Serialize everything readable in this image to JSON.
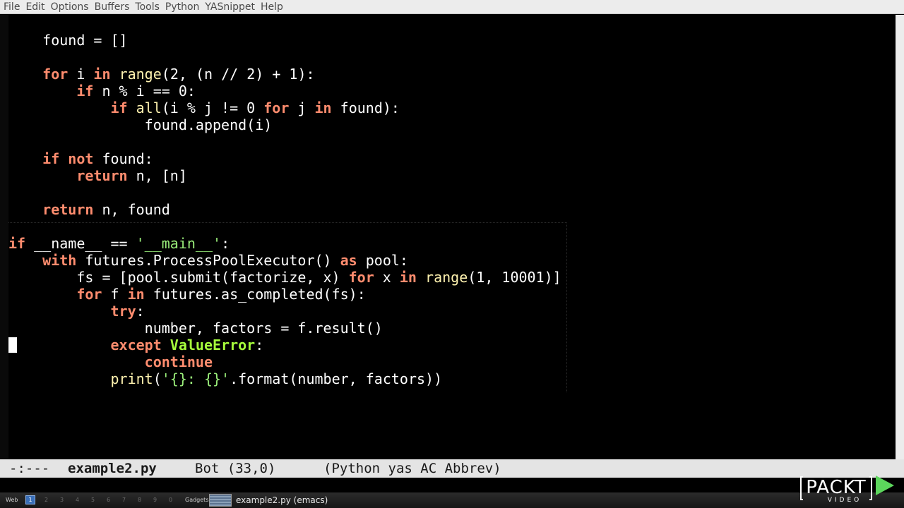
{
  "menubar": {
    "items": [
      "File",
      "Edit",
      "Options",
      "Buffers",
      "Tools",
      "Python",
      "YASnippet",
      "Help"
    ]
  },
  "code": {
    "line1": {
      "indent": "    ",
      "t1": "found = []"
    },
    "line2": {
      "indent": "    ",
      "k1": "for",
      "t1": " i ",
      "k2": "in",
      "t2": " ",
      "b1": "range",
      "t3": "(2, (n // 2) + 1):"
    },
    "line3": {
      "indent": "        ",
      "k1": "if",
      "t1": " n % i == 0:"
    },
    "line4": {
      "indent": "            ",
      "k1": "if",
      "t1": " ",
      "b1": "all",
      "t2": "(i % j != 0 ",
      "k2": "for",
      "t3": " j ",
      "k3": "in",
      "t4": " found):"
    },
    "line5": {
      "indent": "                ",
      "t1": "found.append(i)"
    },
    "line6": {
      "indent": "    ",
      "k1": "if not",
      "t1": " found:"
    },
    "line7": {
      "indent": "        ",
      "k1": "return",
      "t1": " n, [n]"
    },
    "line8": {
      "indent": "    ",
      "k1": "return",
      "t1": " n, found"
    },
    "line9": {
      "k1": "if",
      "t1": " __name__ == ",
      "s1": "'__main__'",
      "t2": ":"
    },
    "line10": {
      "indent": "    ",
      "k1": "with",
      "t1": " futures.ProcessPoolExecutor() ",
      "k2": "as",
      "t2": " pool:"
    },
    "line11": {
      "indent": "        ",
      "t1": "fs = [pool.submit(factorize, x) ",
      "k1": "for",
      "t2": " x ",
      "k2": "in",
      "t3": " ",
      "b1": "range",
      "t4": "(1, 10001)]"
    },
    "line12": {
      "indent": "        ",
      "k1": "for",
      "t1": " f ",
      "k2": "in",
      "t2": " futures.as_completed(fs):"
    },
    "line13": {
      "indent": "            ",
      "k1": "try",
      "t1": ":"
    },
    "line14": {
      "indent": "                ",
      "t1": "number, factors = f.result()"
    },
    "line15": {
      "indent": "            ",
      "k1": "except",
      "t1": " ",
      "e1": "ValueError",
      "t2": ":"
    },
    "line16": {
      "indent": "                ",
      "k1": "continue"
    },
    "line17": {
      "indent": "            ",
      "b1": "print",
      "t1": "(",
      "s1": "'{}: {}'",
      "t2": ".format(number, factors))"
    }
  },
  "modeline": {
    "status": "-:---",
    "buffer_name": "example2.py",
    "position": "Bot (33,0)",
    "modes": "(Python yas AC Abbrev)"
  },
  "taskbar": {
    "web_label": "Web",
    "workspaces": [
      "1",
      "2",
      "3",
      "4",
      "5",
      "6",
      "7",
      "8",
      "9",
      "0"
    ],
    "active_workspace": "1",
    "gadgets_label": "Gadgets",
    "task_title": "example2.py (emacs)"
  },
  "logo": {
    "text": "PACKT",
    "subtext": "VIDEO"
  },
  "colors": {
    "keyword": "#ff8c6e",
    "builtin": "#fff3b0",
    "string": "#9aee7a",
    "exception": "#a7ff3c",
    "logo_green": "#5cd65c"
  }
}
